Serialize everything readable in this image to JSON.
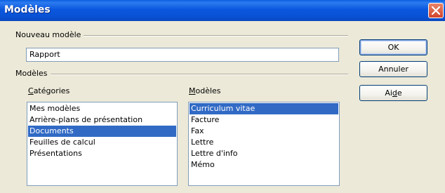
{
  "window": {
    "title": "Modèles"
  },
  "new_template": {
    "group_label": "Nouveau modèle",
    "name_value": "Rapport"
  },
  "templates": {
    "group_label": "Modèles",
    "categories_label_prefix": "",
    "categories_label_key": "C",
    "categories_label_rest": "atégories",
    "templates_label_prefix": "",
    "templates_label_key": "M",
    "templates_label_rest": "odèles",
    "categories": [
      {
        "label": "Mes modèles",
        "selected": false
      },
      {
        "label": "Arrière-plans de présentation",
        "selected": false
      },
      {
        "label": "Documents",
        "selected": true
      },
      {
        "label": "Feuilles de calcul",
        "selected": false
      },
      {
        "label": "Présentations",
        "selected": false
      }
    ],
    "items": [
      {
        "label": "Curriculum vitae",
        "selected": true
      },
      {
        "label": "Facture",
        "selected": false
      },
      {
        "label": "Fax",
        "selected": false
      },
      {
        "label": "Lettre",
        "selected": false
      },
      {
        "label": "Lettre d'info",
        "selected": false
      },
      {
        "label": "Mémo",
        "selected": false
      }
    ]
  },
  "buttons": {
    "ok": "OK",
    "cancel": "Annuler",
    "help_prefix": "Ai",
    "help_key": "d",
    "help_rest": "e"
  },
  "colors": {
    "title_bar": "#0a58de",
    "selection": "#316ac5",
    "dialog_bg": "#ece9d8"
  },
  "icons": {
    "close": "close-icon"
  }
}
